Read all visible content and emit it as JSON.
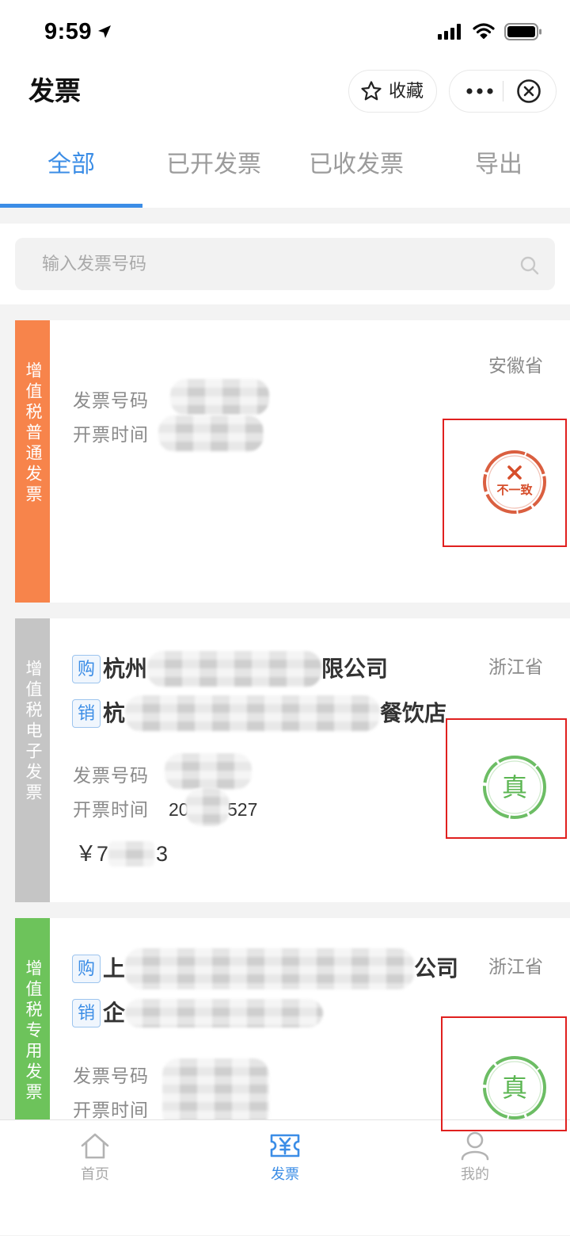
{
  "status_bar": {
    "time": "9:59",
    "icons": [
      "location-arrow-icon",
      "signal-icon",
      "wifi-icon",
      "battery-icon"
    ]
  },
  "header": {
    "title": "发票",
    "favorite_label": "收藏",
    "icons": [
      "star-icon",
      "more-icon",
      "close-circle-icon"
    ]
  },
  "tabs": [
    {
      "label": "全部",
      "active": true
    },
    {
      "label": "已开发票",
      "active": false
    },
    {
      "label": "已收发票",
      "active": false
    },
    {
      "label": "导出",
      "active": false
    }
  ],
  "colors": {
    "accent": "#3b8de6",
    "inactive_tab": "#9b9b9b",
    "page_bg": "#f3f3f3",
    "annotation_box": "#e0201f"
  },
  "search": {
    "placeholder": "输入发票号码",
    "icon": "search-icon"
  },
  "invoices": [
    {
      "type": "增值税普通发票",
      "type_color": "#f7844b",
      "province": "安徽省",
      "number_label": "发票号码",
      "time_label": "开票时间",
      "stamp": {
        "text": "不一致",
        "icon": "cross-icon",
        "color": "#d64e2b"
      }
    },
    {
      "type": "增值税电子发票",
      "type_color": "#c5c5c5",
      "province": "浙江省",
      "buyer": {
        "badge": "购",
        "name_start": "杭州",
        "name_end": "限公司"
      },
      "seller": {
        "badge": "销",
        "name_start": "杭",
        "name_end": "餐饮店"
      },
      "number_label": "发票号码",
      "time_label": "开票时间",
      "time_start": "20",
      "time_end": "527",
      "amount_start": "￥7",
      "amount_end": "3",
      "stamp": {
        "text": "真",
        "color": "#5cb653"
      }
    },
    {
      "type": "增值税专用发票",
      "type_color": "#6dc35b",
      "province": "浙江省",
      "buyer": {
        "badge": "购",
        "name_start": "上",
        "name_end": "公司"
      },
      "seller": {
        "badge": "销",
        "name_start": "企"
      },
      "number_label": "发票号码",
      "time_label": "开票时间",
      "stamp": {
        "text": "真",
        "color": "#5cb653"
      }
    }
  ],
  "bottom_nav": [
    {
      "label": "首页",
      "icon": "home-icon",
      "active": false
    },
    {
      "label": "发票",
      "icon": "invoice-icon",
      "active": true
    },
    {
      "label": "我的",
      "icon": "user-icon",
      "active": false
    }
  ]
}
